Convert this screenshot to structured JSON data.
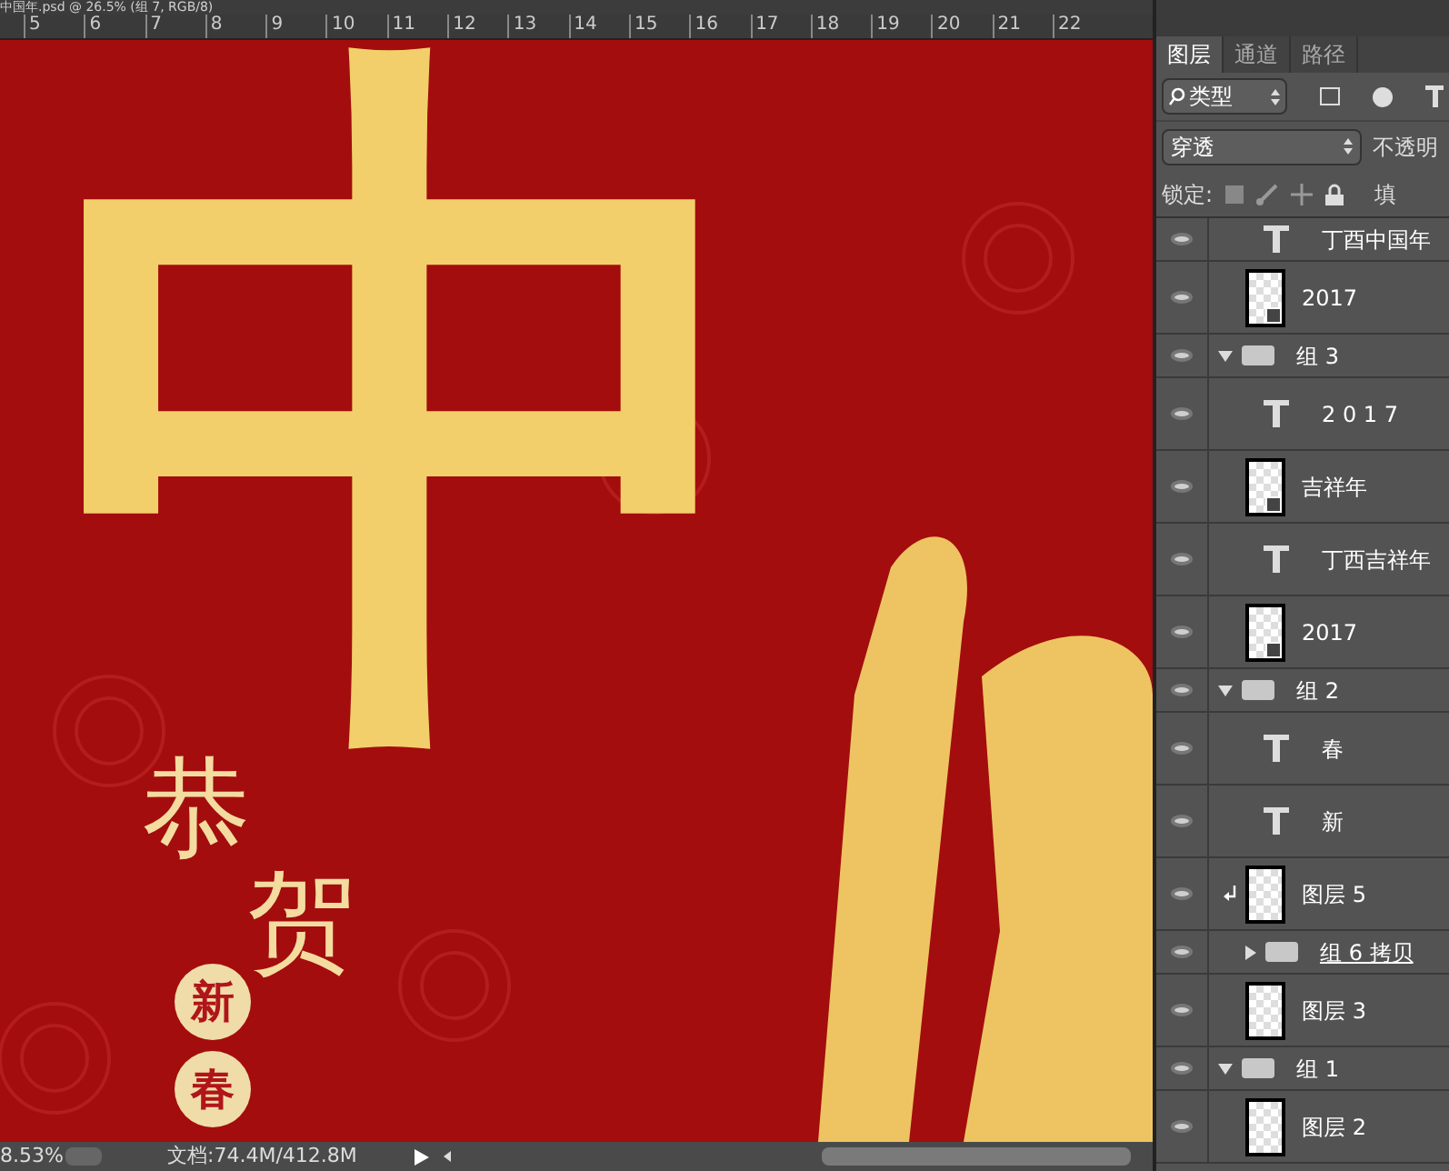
{
  "document_tab": {
    "title": "中国年.psd @ 26.5% (组 7, RGB/8)"
  },
  "ruler": {
    "ticks": [
      "5",
      "6",
      "7",
      "8",
      "9",
      "10",
      "11",
      "12",
      "13",
      "14",
      "15",
      "16",
      "17",
      "18",
      "19",
      "20",
      "21",
      "22"
    ]
  },
  "canvas": {
    "big_character": "中",
    "greeting": [
      "恭",
      "贺"
    ],
    "seals": [
      "新",
      "春"
    ]
  },
  "status_bar": {
    "zoom": "8.53%",
    "document_size": "文档:74.4M/412.8M"
  },
  "layers_panel": {
    "tabs": [
      {
        "label": "图层",
        "selected": true
      },
      {
        "label": "通道",
        "selected": false
      },
      {
        "label": "路径",
        "selected": false
      }
    ],
    "filter": "类型",
    "blend_mode": "穿透",
    "opacity_label": "不透明",
    "lock_label": "锁定:",
    "fill_label": "填",
    "layers": [
      {
        "kind": "text",
        "name": "丁酉中国年",
        "visible": true,
        "clipped": false
      },
      {
        "kind": "smart",
        "name": "2017",
        "visible": true,
        "clipped": false
      },
      {
        "kind": "group",
        "name": "组 3",
        "visible": true,
        "expanded": true,
        "children": [
          {
            "kind": "text",
            "name": "2 0 1 7",
            "visible": true,
            "clipped": false
          },
          {
            "kind": "smart",
            "name": "吉祥年",
            "visible": true,
            "clipped": false
          },
          {
            "kind": "text",
            "name": "丁西吉祥年",
            "visible": true,
            "clipped": false
          },
          {
            "kind": "smart",
            "name": "2017",
            "visible": true,
            "clipped": false
          }
        ]
      },
      {
        "kind": "group",
        "name": "组 2",
        "visible": true,
        "expanded": true,
        "children": [
          {
            "kind": "text",
            "name": "春",
            "visible": true,
            "clipped": false
          },
          {
            "kind": "text",
            "name": "新",
            "visible": true,
            "clipped": false
          },
          {
            "kind": "layer",
            "name": "图层 5",
            "visible": true,
            "clipped": true
          },
          {
            "kind": "group",
            "name": "组 6 拷贝",
            "visible": true,
            "expanded": false
          },
          {
            "kind": "layer",
            "name": "图层 3",
            "visible": true,
            "clipped": false
          }
        ]
      },
      {
        "kind": "group",
        "name": "组 1",
        "visible": true,
        "expanded": true,
        "children": [
          {
            "kind": "layer",
            "name": "图层 2",
            "visible": true,
            "clipped": false
          }
        ]
      }
    ]
  }
}
